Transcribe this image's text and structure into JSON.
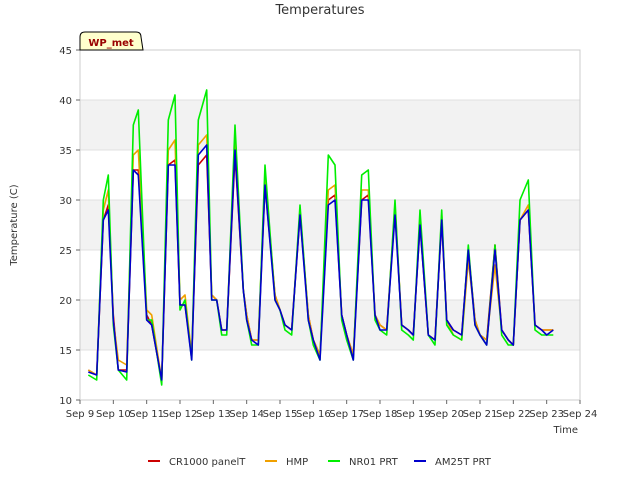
{
  "chart_data": {
    "type": "line",
    "title": "Temperatures",
    "xlabel": "Time",
    "ylabel": "Temperature (C)",
    "station_tag": "WP_met",
    "x_ticks": [
      "Sep 9",
      "Sep 10",
      "Sep 11",
      "Sep 12",
      "Sep 13",
      "Sep 14",
      "Sep 15",
      "Sep 16",
      "Sep 17",
      "Sep 18",
      "Sep 19",
      "Sep 20",
      "Sep 21",
      "Sep 22",
      "Sep 23",
      "Sep 24"
    ],
    "xlim": [
      0,
      15
    ],
    "ylim": [
      10,
      45
    ],
    "y_ticks": [
      10,
      15,
      20,
      25,
      30,
      35,
      40,
      45
    ],
    "grid": true,
    "bands": "alternating gray horizontal bands",
    "legend_position": "bottom",
    "series": [
      {
        "name": "CR1000 panelT",
        "color": "#cc0000",
        "x": [
          0.25,
          0.5,
          0.7,
          0.85,
          1.0,
          1.15,
          1.4,
          1.6,
          1.75,
          2.0,
          2.15,
          2.45,
          2.65,
          2.85,
          3.0,
          3.15,
          3.35,
          3.55,
          3.8,
          3.95,
          4.1,
          4.25,
          4.4,
          4.65,
          4.9,
          5.0,
          5.15,
          5.35,
          5.55,
          5.85,
          6.0,
          6.15,
          6.35,
          6.6,
          6.85,
          7.0,
          7.2,
          7.45,
          7.65,
          7.85,
          8.0,
          8.2,
          8.45,
          8.65,
          8.85,
          9.0,
          9.2,
          9.45,
          9.65,
          9.85,
          10.0,
          10.2,
          10.45,
          10.65,
          10.85,
          11.0,
          11.2,
          11.45,
          11.65,
          11.85,
          12.0,
          12.2,
          12.45,
          12.65,
          12.85,
          13.0,
          13.2,
          13.45,
          13.65,
          13.85,
          14.0,
          14.2
        ],
        "values": [
          13.0,
          12.5,
          28.0,
          29.5,
          18.5,
          13.0,
          13.0,
          33.0,
          33.0,
          18.5,
          17.5,
          12.0,
          33.5,
          34.0,
          19.5,
          19.5,
          14.5,
          33.5,
          34.5,
          20.5,
          20.0,
          17.0,
          17.0,
          34.5,
          21.0,
          18.5,
          16.0,
          16.0,
          31.5,
          20.5,
          19.0,
          17.5,
          17.0,
          28.5,
          18.5,
          16.0,
          14.5,
          30.0,
          30.5,
          18.5,
          16.5,
          14.5,
          30.0,
          30.5,
          18.5,
          17.5,
          17.0,
          29.0,
          17.5,
          17.0,
          16.5,
          27.5,
          16.5,
          16.0,
          28.0,
          18.0,
          17.0,
          16.5,
          25.0,
          18.0,
          16.5,
          16.0,
          25.5,
          17.0,
          16.0,
          15.5,
          28.0,
          29.0,
          17.5,
          17.0,
          17.0,
          17.0
        ]
      },
      {
        "name": "HMP",
        "color": "#f0a000",
        "x": [
          0.25,
          0.5,
          0.7,
          0.85,
          1.0,
          1.15,
          1.4,
          1.6,
          1.75,
          2.0,
          2.15,
          2.45,
          2.65,
          2.85,
          3.0,
          3.15,
          3.35,
          3.55,
          3.8,
          3.95,
          4.1,
          4.25,
          4.4,
          4.65,
          4.9,
          5.0,
          5.15,
          5.35,
          5.55,
          5.85,
          6.0,
          6.15,
          6.35,
          6.6,
          6.85,
          7.0,
          7.2,
          7.45,
          7.65,
          7.85,
          8.0,
          8.2,
          8.45,
          8.65,
          8.85,
          9.0,
          9.2,
          9.45,
          9.65,
          9.85,
          10.0,
          10.2,
          10.45,
          10.65,
          10.85,
          11.0,
          11.2,
          11.45,
          11.65,
          11.85,
          12.0,
          12.2,
          12.45,
          12.65,
          12.85,
          13.0,
          13.2,
          13.45,
          13.65,
          13.85,
          14.0,
          14.2
        ],
        "values": [
          13.0,
          12.5,
          29.0,
          31.0,
          18.0,
          14.0,
          13.5,
          34.5,
          35.0,
          19.0,
          18.5,
          12.0,
          35.0,
          36.0,
          20.0,
          20.5,
          14.5,
          35.5,
          36.5,
          20.5,
          20.0,
          17.0,
          17.0,
          36.0,
          21.0,
          18.5,
          16.0,
          16.0,
          32.5,
          20.5,
          19.0,
          17.5,
          17.0,
          29.0,
          18.5,
          16.0,
          14.5,
          31.0,
          31.5,
          18.5,
          16.5,
          14.5,
          31.0,
          31.0,
          18.5,
          17.5,
          17.0,
          29.5,
          17.5,
          17.0,
          16.5,
          28.0,
          16.5,
          16.0,
          28.5,
          18.0,
          16.5,
          16.0,
          24.0,
          18.0,
          16.5,
          16.0,
          23.5,
          17.0,
          16.0,
          15.5,
          28.0,
          29.5,
          17.5,
          17.0,
          17.0,
          17.0
        ]
      },
      {
        "name": "NR01 PRT",
        "color": "#00ee00",
        "x": [
          0.25,
          0.5,
          0.7,
          0.85,
          1.0,
          1.15,
          1.4,
          1.6,
          1.75,
          2.0,
          2.15,
          2.45,
          2.65,
          2.85,
          3.0,
          3.15,
          3.35,
          3.55,
          3.8,
          3.95,
          4.1,
          4.25,
          4.4,
          4.65,
          4.9,
          5.0,
          5.15,
          5.35,
          5.55,
          5.85,
          6.0,
          6.15,
          6.35,
          6.6,
          6.85,
          7.0,
          7.2,
          7.45,
          7.65,
          7.85,
          8.0,
          8.2,
          8.45,
          8.65,
          8.85,
          9.0,
          9.2,
          9.45,
          9.65,
          9.85,
          10.0,
          10.2,
          10.45,
          10.65,
          10.85,
          11.0,
          11.2,
          11.45,
          11.65,
          11.85,
          12.0,
          12.2,
          12.45,
          12.65,
          12.85,
          13.0,
          13.2,
          13.45,
          13.65,
          13.85,
          14.0,
          14.2
        ],
        "values": [
          12.5,
          12.0,
          30.0,
          32.5,
          17.5,
          13.0,
          12.0,
          37.5,
          39.0,
          18.0,
          18.0,
          11.5,
          38.0,
          40.5,
          19.0,
          20.0,
          14.0,
          38.0,
          41.0,
          20.0,
          20.0,
          16.5,
          16.5,
          37.5,
          21.0,
          18.0,
          15.5,
          15.5,
          33.5,
          20.0,
          19.0,
          17.0,
          16.5,
          29.5,
          18.0,
          15.5,
          14.0,
          34.5,
          33.5,
          18.0,
          16.0,
          14.0,
          32.5,
          33.0,
          18.0,
          17.0,
          16.5,
          30.0,
          17.0,
          16.5,
          16.0,
          29.0,
          16.5,
          15.5,
          29.0,
          17.5,
          16.5,
          16.0,
          25.5,
          17.5,
          16.5,
          15.5,
          25.5,
          16.5,
          15.5,
          15.5,
          30.0,
          32.0,
          17.0,
          16.5,
          16.5,
          16.5
        ]
      },
      {
        "name": "AM25T PRT",
        "color": "#0000cc",
        "x": [
          0.25,
          0.5,
          0.7,
          0.85,
          1.0,
          1.15,
          1.4,
          1.6,
          1.75,
          2.0,
          2.15,
          2.45,
          2.65,
          2.85,
          3.0,
          3.15,
          3.35,
          3.55,
          3.8,
          3.95,
          4.1,
          4.25,
          4.4,
          4.65,
          4.9,
          5.0,
          5.15,
          5.35,
          5.55,
          5.85,
          6.0,
          6.15,
          6.35,
          6.6,
          6.85,
          7.0,
          7.2,
          7.45,
          7.65,
          7.85,
          8.0,
          8.2,
          8.45,
          8.65,
          8.85,
          9.0,
          9.2,
          9.45,
          9.65,
          9.85,
          10.0,
          10.2,
          10.45,
          10.65,
          10.85,
          11.0,
          11.2,
          11.45,
          11.65,
          11.85,
          12.0,
          12.2,
          12.45,
          12.65,
          12.85,
          13.0,
          13.2,
          13.45,
          13.65,
          13.85,
          14.0,
          14.2
        ],
        "values": [
          12.8,
          12.5,
          28.0,
          29.0,
          18.0,
          13.0,
          12.8,
          33.0,
          32.5,
          18.0,
          17.5,
          12.0,
          33.5,
          33.5,
          19.5,
          19.5,
          14.0,
          34.5,
          35.5,
          20.0,
          20.0,
          17.0,
          17.0,
          35.0,
          21.0,
          18.0,
          16.0,
          15.5,
          31.5,
          20.0,
          19.0,
          17.5,
          17.0,
          28.5,
          18.0,
          16.0,
          14.0,
          29.5,
          30.0,
          18.5,
          16.5,
          14.0,
          30.0,
          30.0,
          18.5,
          17.0,
          17.0,
          28.5,
          17.5,
          17.0,
          16.5,
          27.5,
          16.5,
          16.0,
          28.0,
          18.0,
          17.0,
          16.5,
          25.0,
          17.5,
          16.5,
          15.5,
          25.0,
          17.0,
          16.0,
          15.5,
          28.0,
          29.0,
          17.5,
          17.0,
          16.5,
          17.0
        ]
      }
    ]
  }
}
